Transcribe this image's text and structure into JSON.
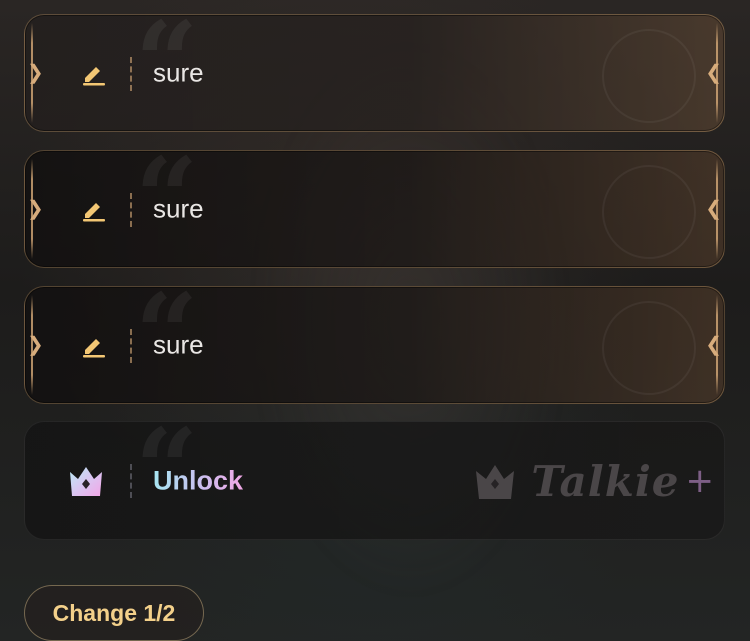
{
  "options": [
    {
      "text": "sure",
      "icon": "edit-icon"
    },
    {
      "text": "sure",
      "icon": "edit-icon"
    },
    {
      "text": "sure",
      "icon": "edit-icon"
    }
  ],
  "unlock": {
    "label": "Unlock",
    "icon": "crown-icon"
  },
  "brand": {
    "name": "Talkie",
    "suffix": "+"
  },
  "change_button": {
    "label": "Change 1/2"
  },
  "colors": {
    "accent_gold": "#f3d08a",
    "frame_gold": "#d7ac7c",
    "unlock_gradient": [
      "#a7e6f2",
      "#f0a6e6"
    ]
  }
}
